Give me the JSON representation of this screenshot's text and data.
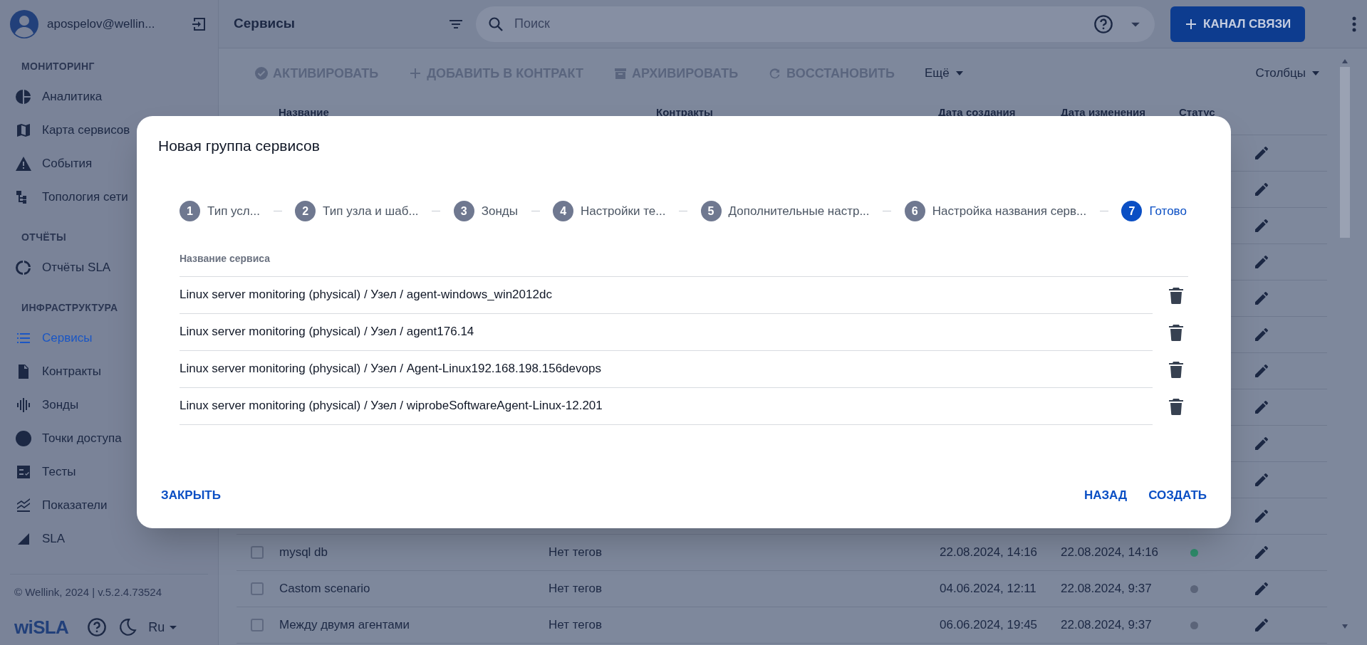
{
  "sidebar": {
    "user": {
      "email": "apospelov@wellin..."
    },
    "sections": [
      {
        "title": "МОНИТОРИНГ",
        "items": [
          {
            "label": "Аналитика",
            "selected": false
          },
          {
            "label": "Карта сервисов",
            "selected": false
          },
          {
            "label": "События",
            "selected": false
          },
          {
            "label": "Топология сети",
            "selected": false
          }
        ]
      },
      {
        "title": "ОТЧЁТЫ",
        "items": [
          {
            "label": "Отчёты SLA",
            "selected": false
          }
        ]
      },
      {
        "title": "ИНФРАСТРУКТУРА",
        "items": [
          {
            "label": "Сервисы",
            "selected": true
          },
          {
            "label": "Контракты",
            "selected": false
          },
          {
            "label": "Зонды",
            "selected": false
          },
          {
            "label": "Точки доступа",
            "selected": false
          },
          {
            "label": "Тесты",
            "selected": false
          },
          {
            "label": "Показатели",
            "selected": false
          },
          {
            "label": "SLA",
            "selected": false
          }
        ]
      }
    ],
    "footer": {
      "copyright": "© Wellink, 2024 | v.5.2.4.73524",
      "logo": "wiSLA",
      "language": "Ru"
    }
  },
  "topbar": {
    "title": "Сервисы",
    "search": {
      "placeholder": "Поиск"
    },
    "primary_button": "КАНАЛ СВЯЗИ"
  },
  "toolbar": {
    "actions": [
      {
        "label": "АКТИВИРОВАТЬ",
        "disabled": true
      },
      {
        "label": "ДОБАВИТЬ В КОНТРАКТ",
        "disabled": true
      },
      {
        "label": "АРХИВИРОВАТЬ",
        "disabled": true
      },
      {
        "label": "ВОССТАНОВИТЬ",
        "disabled": true
      }
    ],
    "more": "Ещё",
    "columns": "Столбцы"
  },
  "table": {
    "columns": [
      "Название",
      "Контракты",
      "Дата создания",
      "Дата изменения",
      "Статус"
    ],
    "rows": [
      {
        "kind": "covered"
      },
      {
        "kind": "covered"
      },
      {
        "kind": "covered"
      },
      {
        "kind": "covered"
      },
      {
        "kind": "covered"
      },
      {
        "kind": "covered"
      },
      {
        "kind": "covered"
      },
      {
        "kind": "covered"
      },
      {
        "kind": "covered"
      },
      {
        "kind": "covered"
      },
      {
        "kind": "covered"
      },
      {
        "kind": "full",
        "checked": false,
        "name": "mysql db",
        "contracts": "Нет тегов",
        "created": "22.08.2024, 14:16",
        "modified": "22.08.2024, 14:16",
        "color": "#2e8b6a"
      },
      {
        "kind": "full",
        "checked": false,
        "name": "Castom scenario",
        "contracts": "Нет тегов",
        "created": "04.06.2024, 12:11",
        "modified": "22.08.2024, 9:37",
        "color": "#5b6479"
      },
      {
        "kind": "full",
        "checked": false,
        "name": "Между двумя агентами",
        "contracts": "Нет тегов",
        "created": "06.06.2024, 19:45",
        "modified": "22.08.2024, 9:37",
        "color": "#5b6479"
      }
    ]
  },
  "dialog": {
    "title": "Новая группа сервисов",
    "steps": [
      {
        "number": "1",
        "label": "Тип усл...",
        "selected": false
      },
      {
        "number": "2",
        "label": "Тип узла и шаб...",
        "selected": false
      },
      {
        "number": "3",
        "label": "Зонды",
        "selected": false
      },
      {
        "number": "4",
        "label": "Настройки те...",
        "selected": false
      },
      {
        "number": "5",
        "label": "Дополнительные настр...",
        "selected": false
      },
      {
        "number": "6",
        "label": "Настройка названия серв...",
        "selected": false
      },
      {
        "number": "7",
        "label": "Готово",
        "selected": true
      }
    ],
    "list_header": "Название сервиса",
    "services": [
      {
        "name": "Linux server monitoring (physical) / Узел / agent-windows_win2012dc"
      },
      {
        "name": "Linux server monitoring (physical) / Узел / agent176.14"
      },
      {
        "name": "Linux server monitoring (physical) / Узел / Agent-Linux192.168.198.156devops"
      },
      {
        "name": "Linux server monitoring (physical) / Узел / wiprobeSoftwareAgent-Linux-12.201"
      }
    ],
    "buttons": {
      "close": "ЗАКРЫТЬ",
      "back": "НАЗАД",
      "create": "СОЗДАТЬ"
    }
  }
}
